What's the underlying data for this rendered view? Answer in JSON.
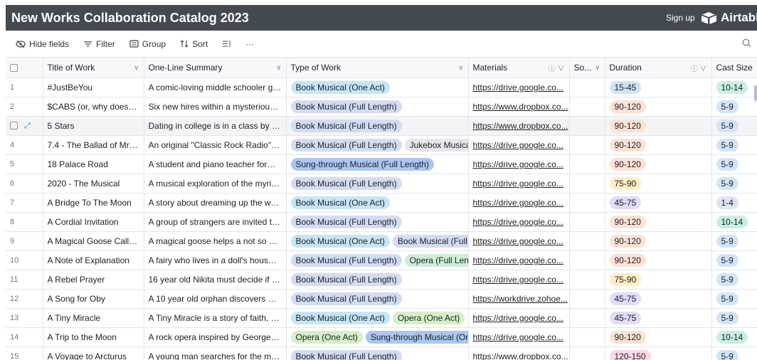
{
  "app": {
    "title": "New Works Collaboration Catalog 2023",
    "signup": "Sign up",
    "brand": "Airtable"
  },
  "toolbar": {
    "hide_fields": "Hide fields",
    "filter": "Filter",
    "group": "Group",
    "sort": "Sort",
    "more": "···"
  },
  "columns": {
    "title": "Title of Work",
    "summary": "One-Line Summary",
    "type": "Type of Work",
    "materials": "Materials",
    "source": "So...",
    "duration": "Duration",
    "cast": "Cast Size"
  },
  "rows": [
    {
      "num": "1",
      "title": "#JustBeYou",
      "summary": "A comic-loving middle schooler gr...",
      "types": [
        {
          "label": "Book Musical (One Act)",
          "color": "#c5e6f8"
        }
      ],
      "materials": "https://drive.google.co...",
      "duration": {
        "label": "15-45",
        "color": "#cde3f8"
      },
      "cast": {
        "label": "10-14",
        "color": "#c7f0e2"
      }
    },
    {
      "num": "2",
      "title": "$CABS (or, why does n...",
      "summary": "Six new hires within a mysterious ...",
      "types": [
        {
          "label": "Book Musical (Full Length)",
          "color": "#d3dcf3"
        }
      ],
      "materials": "https://www.dropbox.co...",
      "duration": {
        "label": "90-120",
        "color": "#fde1d4"
      },
      "cast": {
        "label": "5-9",
        "color": "#d1e4f9"
      }
    },
    {
      "num": "",
      "title": "5 Stars",
      "summary": "Dating in college is in a class by its...",
      "types": [
        {
          "label": "Book Musical (Full Length)",
          "color": "#d3dcf3"
        }
      ],
      "materials": "https://www.dropbox.co...",
      "duration": {
        "label": "90-120",
        "color": "#fde1d4"
      },
      "cast": {
        "label": "5-9",
        "color": "#d1e4f9"
      }
    },
    {
      "num": "4",
      "title": "7.4 - The Ballad of Mrs....",
      "summary": "An original \"Classic Rock Radio\" m...",
      "types": [
        {
          "label": "Book Musical (Full Length)",
          "color": "#d3dcf3"
        },
        {
          "label": "Jukebox Musical",
          "color": "#e5e7ea"
        }
      ],
      "materials": "https://drive.google.co...",
      "duration": {
        "label": "90-120",
        "color": "#fde1d4"
      },
      "cast": {
        "label": "5-9",
        "color": "#d1e4f9"
      }
    },
    {
      "num": "5",
      "title": "18 Palace Road",
      "summary": "A student and piano teacher form ...",
      "types": [
        {
          "label": "Sung-through Musical (Full Length)",
          "color": "#a9c7f2"
        }
      ],
      "materials": "https://drive.google.co...",
      "duration": {
        "label": "90-120",
        "color": "#fde1d4"
      },
      "cast": {
        "label": "5-9",
        "color": "#d1e4f9"
      }
    },
    {
      "num": "6",
      "title": "2020 - The Musical",
      "summary": "A musical exploration of the myria...",
      "types": [
        {
          "label": "Book Musical (Full Length)",
          "color": "#d3dcf3"
        }
      ],
      "materials": "https://drive.google.co...",
      "duration": {
        "label": "75-90",
        "color": "#fdefc2"
      },
      "cast": {
        "label": "5-9",
        "color": "#d1e4f9"
      }
    },
    {
      "num": "7",
      "title": "A Bridge To The Moon",
      "summary": "A story about dreaming up the wor...",
      "types": [
        {
          "label": "Book Musical (One Act)",
          "color": "#c5e6f8"
        }
      ],
      "materials": "https://drive.google.co...",
      "duration": {
        "label": "45-75",
        "color": "#e2dcf7"
      },
      "cast": {
        "label": "1-4",
        "color": "#dfe4f5"
      }
    },
    {
      "num": "8",
      "title": "A Cordial Invitation",
      "summary": "A group of strangers are invited to ...",
      "types": [
        {
          "label": "Book Musical (Full Length)",
          "color": "#d3dcf3"
        }
      ],
      "materials": "https://drive.google.co...",
      "duration": {
        "label": "90-120",
        "color": "#fde1d4"
      },
      "cast": {
        "label": "10-14",
        "color": "#c7f0e2"
      }
    },
    {
      "num": "9",
      "title": "A Magical Goose Calle...",
      "summary": "A magical goose helps a not so or...",
      "types": [
        {
          "label": "Book Musical (One Act)",
          "color": "#c5e6f8"
        },
        {
          "label": "Book Musical (Full Le",
          "color": "#d3dcf3"
        }
      ],
      "materials": "https://drive.google.co...",
      "duration": {
        "label": "90-120",
        "color": "#fde1d4"
      },
      "cast": {
        "label": "5-9",
        "color": "#d1e4f9"
      }
    },
    {
      "num": "10",
      "title": "A Note of Explanation",
      "summary": "A fairy who lives in a doll's house i...",
      "types": [
        {
          "label": "Book Musical (Full Length)",
          "color": "#d3dcf3"
        },
        {
          "label": "Opera (Full Length",
          "color": "#cdeed7"
        }
      ],
      "materials": "https://drive.google.co...",
      "duration": {
        "label": "90-120",
        "color": "#fde1d4"
      },
      "cast": {
        "label": "5-9",
        "color": "#d1e4f9"
      }
    },
    {
      "num": "11",
      "title": "A Rebel Prayer",
      "summary": "16 year old Nikita must decide if ar...",
      "types": [
        {
          "label": "Book Musical (Full Length)",
          "color": "#d3dcf3"
        }
      ],
      "materials": "https://drive.google.co...",
      "duration": {
        "label": "75-90",
        "color": "#fdefc2"
      },
      "cast": {
        "label": "5-9",
        "color": "#d1e4f9"
      }
    },
    {
      "num": "12",
      "title": "A Song for Oby",
      "summary": "A 10 year old orphan discovers ma...",
      "types": [
        {
          "label": "Book Musical (Full Length)",
          "color": "#d3dcf3"
        }
      ],
      "materials": "https://workdrive.zohoe...",
      "duration": {
        "label": "45-75",
        "color": "#e2dcf7"
      },
      "cast": {
        "label": "5-9",
        "color": "#d1e4f9"
      }
    },
    {
      "num": "13",
      "title": "A Tiny Miracle",
      "summary": "A Tiny Miracle is a story of faith, g...",
      "types": [
        {
          "label": "Book Musical (One Act)",
          "color": "#c5e6f8"
        },
        {
          "label": "Opera (One Act)",
          "color": "#d5f0c8"
        }
      ],
      "materials": "https://drive.google.co...",
      "duration": {
        "label": "45-75",
        "color": "#e2dcf7"
      },
      "cast": {
        "label": "5-9",
        "color": "#d1e4f9"
      }
    },
    {
      "num": "14",
      "title": "A Trip to the Moon",
      "summary": "A rock opera inspired by George M...",
      "types": [
        {
          "label": "Opera (One Act)",
          "color": "#d5f0c8"
        },
        {
          "label": "Sung-through Musical (One",
          "color": "#a9c7f2"
        }
      ],
      "materials": "https://drive.google.co...",
      "duration": {
        "label": "90-120",
        "color": "#fde1d4"
      },
      "cast": {
        "label": "10-14",
        "color": "#c7f0e2"
      }
    },
    {
      "num": "15",
      "title": "A Voyage to Arcturus",
      "summary": "A young man searches for the mea...",
      "types": [
        {
          "label": "Book Musical (Full Length)",
          "color": "#d3dcf3"
        }
      ],
      "materials": "https://www.dropbox.co...",
      "duration": {
        "label": "120-150",
        "color": "#fbd9e6"
      },
      "cast": {
        "label": "5-9",
        "color": "#d1e4f9"
      }
    }
  ]
}
